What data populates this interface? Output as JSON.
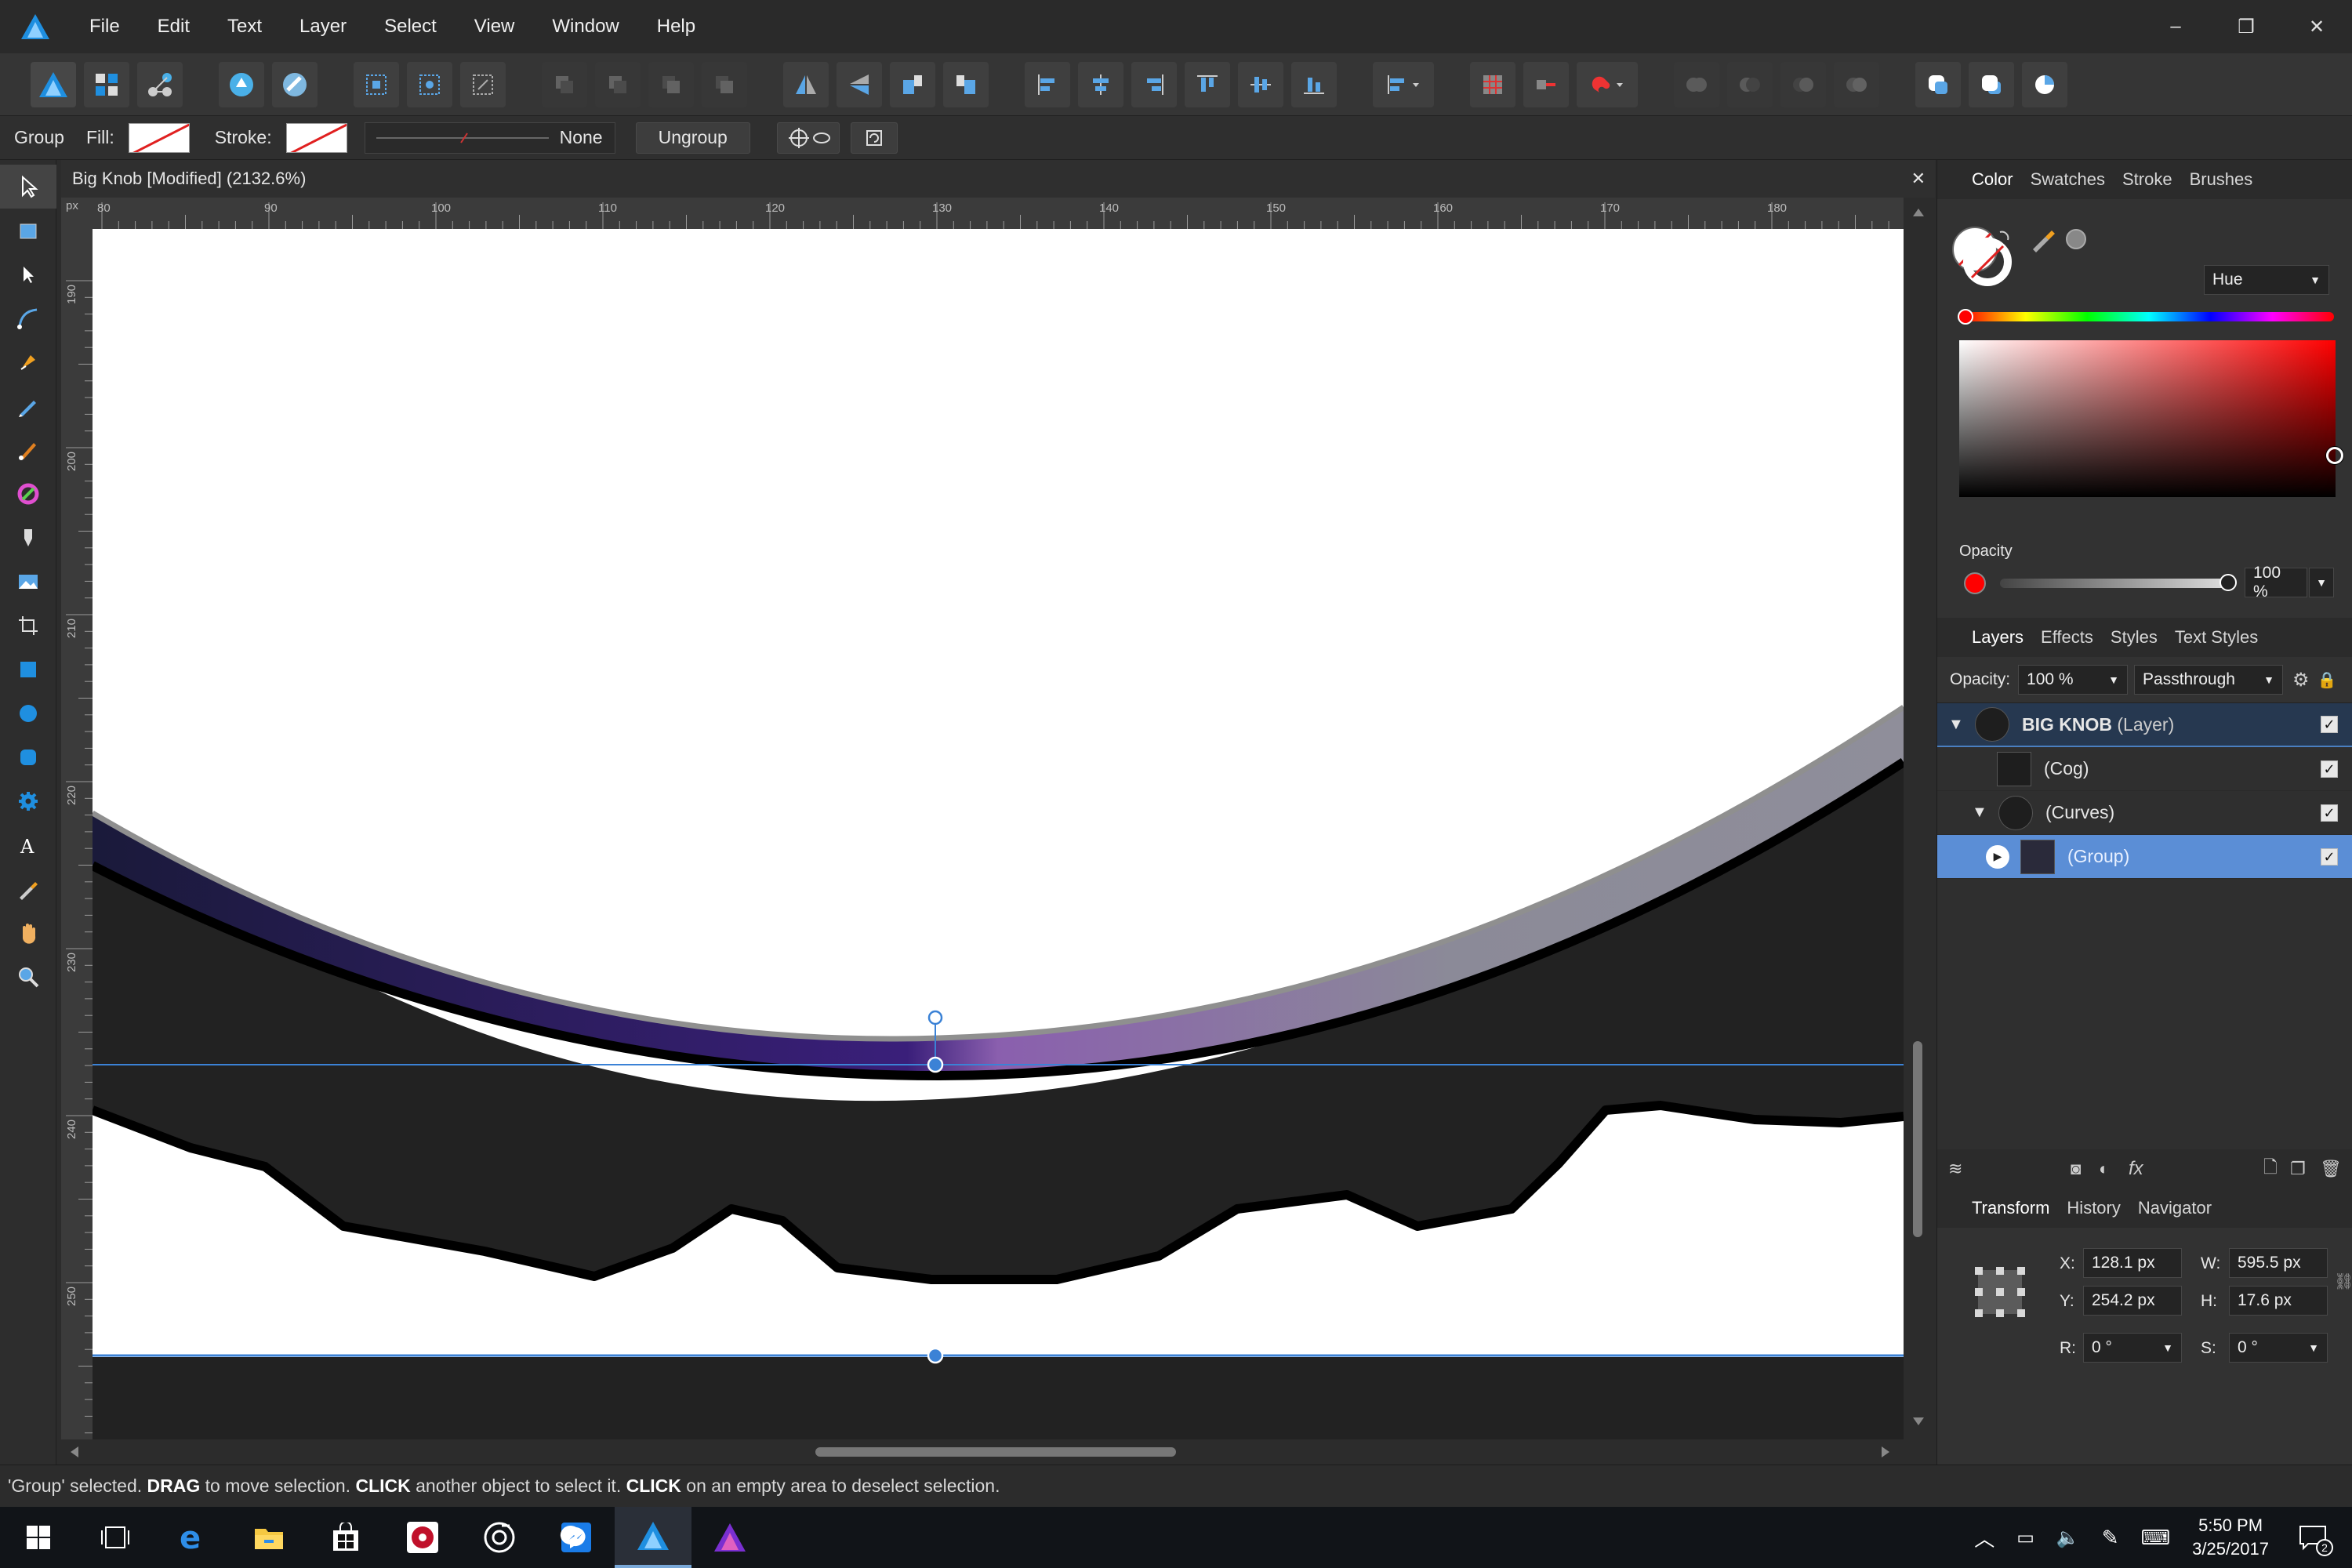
{
  "menubar": {
    "items": [
      "File",
      "Edit",
      "Text",
      "Layer",
      "Select",
      "View",
      "Window",
      "Help"
    ],
    "window_controls": [
      "–",
      "❒",
      "✕"
    ]
  },
  "contextbar": {
    "group_label": "Group",
    "fill_label": "Fill:",
    "stroke_label": "Stroke:",
    "stroke_width_value": "None",
    "ungroup_label": "Ungroup"
  },
  "document": {
    "tab_title": "Big Knob [Modified] (2132.6%)",
    "close_glyph": "✕",
    "ruler_unit": "px",
    "ruler_top_labels": [
      "80",
      "90",
      "100",
      "110",
      "120",
      "130",
      "140",
      "150",
      "160",
      "170",
      "180"
    ],
    "ruler_left_labels": [
      "190",
      "200",
      "210",
      "220",
      "230",
      "240",
      "250"
    ]
  },
  "color_panel": {
    "tabs": [
      "Color",
      "Swatches",
      "Stroke",
      "Brushes"
    ],
    "mode": "Hue",
    "opacity_label": "Opacity",
    "opacity_value": "100 %",
    "colors": {
      "current": "#ff0000",
      "accent": "#5b8ed6"
    }
  },
  "layers_panel": {
    "tabs": [
      "Layers",
      "Effects",
      "Styles",
      "Text Styles"
    ],
    "opacity_label": "Opacity:",
    "opacity_value": "100 %",
    "blend_mode": "Passthrough",
    "layers": [
      {
        "name": "BIG KNOB",
        "type": "(Layer)",
        "expanded": true,
        "visible": true,
        "selected": false
      },
      {
        "name": "(Cog)",
        "type": "",
        "expanded": false,
        "visible": true,
        "selected": false
      },
      {
        "name": "(Curves)",
        "type": "",
        "expanded": true,
        "visible": true,
        "selected": false
      },
      {
        "name": "(Group)",
        "type": "",
        "expanded": false,
        "visible": true,
        "selected": true
      }
    ],
    "fx_label": "fx"
  },
  "transform_panel": {
    "tabs": [
      "Transform",
      "History",
      "Navigator"
    ],
    "x_label": "X:",
    "x_value": "128.1 px",
    "y_label": "Y:",
    "y_value": "254.2 px",
    "w_label": "W:",
    "w_value": "595.5 px",
    "h_label": "H:",
    "h_value": "17.6 px",
    "r_label": "R:",
    "r_value": "0 °",
    "s_label": "S:",
    "s_value": "0 °"
  },
  "statusbar": {
    "part1": "'Group' selected. ",
    "drag": "DRAG",
    "part2": " to move selection. ",
    "click1": "CLICK",
    "part3": " another object to select it. ",
    "click2": "CLICK",
    "part4": " on an empty area to deselect selection."
  },
  "taskbar": {
    "time": "5:50 PM",
    "date": "3/25/2017",
    "notification_count": "2"
  }
}
